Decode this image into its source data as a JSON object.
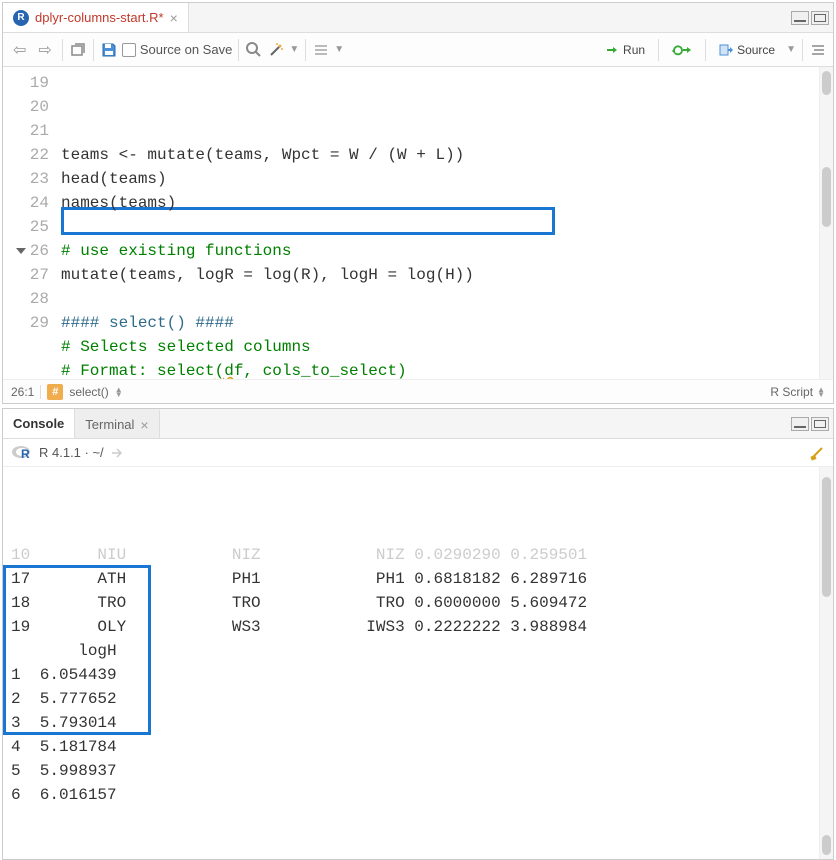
{
  "editor": {
    "tab_title": "dplyr-columns-start.R*",
    "source_on_save": "Source on Save",
    "run": "Run",
    "source": "Source",
    "lines": [
      {
        "n": "19",
        "raw": "teams <- mutate(teams, Wpct = W / (W + L))"
      },
      {
        "n": "20",
        "raw": "head(teams)"
      },
      {
        "n": "21",
        "raw": "names(teams)"
      },
      {
        "n": "22",
        "raw": ""
      },
      {
        "n": "23",
        "raw": "# use existing functions",
        "cls": "comment"
      },
      {
        "n": "24",
        "raw": "mutate(teams, logR = log(R), logH = log(H))"
      },
      {
        "n": "25",
        "raw": ""
      },
      {
        "n": "26",
        "raw": "#### select() ####",
        "cls": "section",
        "fold": true
      },
      {
        "n": "27",
        "raw": "# Selects selected columns",
        "cls": "comment"
      },
      {
        "n": "28",
        "raw": "# Format: select(df, cols_to_select)",
        "cls": "comment",
        "wavyStart": 16,
        "wavyEnd": 18
      },
      {
        "n": "29",
        "raw": ""
      }
    ],
    "status": {
      "pos": "26:1",
      "section": "select()",
      "type": "R Script"
    }
  },
  "console": {
    "tabs": [
      "Console",
      "Terminal"
    ],
    "version": "R 4.1.1 · ~/",
    "lines": [
      "10       NIU           NIZ            NIZ 0.0290290 0.259501",
      "17       ATH           PH1            PH1 0.6818182 6.289716",
      "18       TRO           TRO            TRO 0.6000000 5.609472",
      "19       OLY           WS3           IWS3 0.2222222 3.988984",
      "       logH",
      "1  6.054439",
      "2  5.777652",
      "3  5.793014",
      "4  5.181784",
      "5  5.998937",
      "6  6.016157"
    ]
  }
}
